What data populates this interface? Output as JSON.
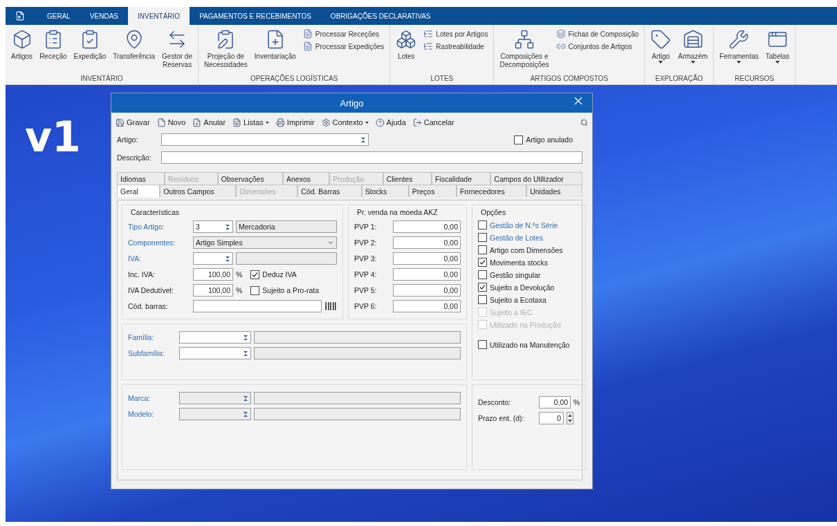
{
  "ribbon_tabs": [
    {
      "label": "GERAL",
      "selected": false
    },
    {
      "label": "VENDAS",
      "selected": false
    },
    {
      "label": "INVENTÁRIO",
      "selected": true
    },
    {
      "label": "PAGAMENTOS E RECEBIMENTOS",
      "selected": false
    },
    {
      "label": "OBRIGAÇÕES DECLARATIVAS",
      "selected": false
    }
  ],
  "ribbon_groups": [
    {
      "label": "INVENTÁRIO",
      "items": [
        {
          "kind": "large",
          "label": "Artigos"
        },
        {
          "kind": "large",
          "label": "Receção"
        },
        {
          "kind": "large",
          "label": "Expedição"
        },
        {
          "kind": "large",
          "label": "Transferência"
        },
        {
          "kind": "large",
          "label": "Gestor de\nReservas"
        }
      ]
    },
    {
      "label": "OPERAÇÕES LOGÍSTICAS",
      "items": [
        {
          "kind": "large",
          "label": "Projeção de\nNecessidades"
        },
        {
          "kind": "large",
          "label": "Inventariação"
        },
        {
          "kind": "small",
          "label": "Processar Receções"
        },
        {
          "kind": "small",
          "label": "Processar Expedições"
        }
      ]
    },
    {
      "label": "LOTES",
      "items": [
        {
          "kind": "large",
          "label": "Lotes"
        },
        {
          "kind": "small",
          "label": "Lotes por Artigos"
        },
        {
          "kind": "small",
          "label": "Rastreabilidade"
        }
      ]
    },
    {
      "label": "ARTIGOS COMPOSTOS",
      "items": [
        {
          "kind": "large",
          "label": "Composições e\nDecomposições"
        },
        {
          "kind": "small",
          "label": "Fichas de Composição"
        },
        {
          "kind": "small",
          "label": "Conjuntos de Artigos"
        }
      ]
    },
    {
      "label": "EXPLORAÇÃO",
      "items": [
        {
          "kind": "menu",
          "label": "Artigo"
        },
        {
          "kind": "menu",
          "label": "Armazém"
        }
      ]
    },
    {
      "label": "RECURSOS",
      "items": [
        {
          "kind": "menu",
          "label": "Ferramentas"
        },
        {
          "kind": "menu",
          "label": "Tabelas"
        }
      ]
    }
  ],
  "desktop": {
    "logo": "v1"
  },
  "dialog": {
    "title": "Artigo",
    "toolbar": [
      {
        "label": "Gravar",
        "dropdown": false
      },
      {
        "label": "Novo",
        "dropdown": false
      },
      {
        "label": "Anular",
        "dropdown": false
      },
      {
        "label": "Listas",
        "dropdown": true
      },
      {
        "label": "Imprimir",
        "dropdown": false
      },
      {
        "label": "Contexto",
        "dropdown": true
      },
      {
        "label": "Ajuda",
        "dropdown": false
      },
      {
        "label": "Cancelar",
        "dropdown": false
      }
    ],
    "artigo": {
      "label": "Artigo:"
    },
    "descricao": {
      "label": "Descrição:"
    },
    "artigo_anulado": {
      "label": "Artigo anulado",
      "checked": false
    },
    "tab_rows": [
      [
        {
          "label": "Idiomas",
          "selected": false,
          "disabled": false
        },
        {
          "label": "Resíduos",
          "selected": false,
          "disabled": true
        },
        {
          "label": "Observações",
          "selected": false,
          "disabled": false
        },
        {
          "label": "Anexos",
          "selected": false,
          "disabled": false
        },
        {
          "label": "Produção",
          "selected": false,
          "disabled": true
        },
        {
          "label": "Clientes",
          "selected": false,
          "disabled": false
        },
        {
          "label": "Fiscalidade",
          "selected": false,
          "disabled": false
        },
        {
          "label": "Campos do Utilizador",
          "selected": false,
          "disabled": false
        }
      ],
      [
        {
          "label": "Geral",
          "selected": true,
          "disabled": false
        },
        {
          "label": "Outros Campos",
          "selected": false,
          "disabled": false
        },
        {
          "label": "Dimensões",
          "selected": false,
          "disabled": true
        },
        {
          "label": "Cód. Barras",
          "selected": false,
          "disabled": false
        },
        {
          "label": "Stocks",
          "selected": false,
          "disabled": false
        },
        {
          "label": "Preços",
          "selected": false,
          "disabled": false
        },
        {
          "label": "Fornecedores",
          "selected": false,
          "disabled": false
        },
        {
          "label": "Unidades",
          "selected": false,
          "disabled": false
        }
      ]
    ],
    "caracteristicas": {
      "title": "Características",
      "tipo_artigo": {
        "label": "Tipo Artigo:",
        "link": true,
        "value": "3",
        "description": "Mercadoria"
      },
      "componentes": {
        "label": "Componentes:",
        "link": true,
        "value": "Artigo Simples"
      },
      "iva": {
        "label": "IVA:",
        "link": true
      },
      "inc_iva": {
        "label": "Inc. IVA:",
        "link": false,
        "value": "100,00",
        "unit": "%",
        "check": {
          "label": "Deduz IVA",
          "checked": true
        }
      },
      "iva_dedutivel": {
        "label": "IVA Dedutível:",
        "link": false,
        "value": "100,00",
        "unit": "%",
        "check": {
          "label": "Sujeito a Pro-rata",
          "checked": false
        }
      },
      "cod_barras": {
        "label": "Cód. barras:",
        "link": false
      }
    },
    "precos": {
      "title": "Pr. venda na moeda AKZ",
      "rows": [
        {
          "label": "PVP 1:",
          "value": "0,00"
        },
        {
          "label": "PVP 2:",
          "value": "0,00"
        },
        {
          "label": "PVP 3:",
          "value": "0,00"
        },
        {
          "label": "PVP 4:",
          "value": "0,00"
        },
        {
          "label": "PVP 5:",
          "value": "0,00"
        },
        {
          "label": "PVP 6:",
          "value": "0,00"
        }
      ]
    },
    "opcoes": {
      "title": "Opções",
      "items": [
        {
          "label": "Gestão de N.ºs Série",
          "checked": false,
          "disabled": false,
          "link": true
        },
        {
          "label": "Gestão de Lotes",
          "checked": false,
          "disabled": false,
          "link": true
        },
        {
          "label": "Artigo com Dimensões",
          "checked": false,
          "disabled": false,
          "link": false
        },
        {
          "label": "Movimenta stocks",
          "checked": true,
          "disabled": false,
          "link": false
        },
        {
          "label": "Gestão singular",
          "checked": false,
          "disabled": false,
          "link": false
        },
        {
          "label": "Sujeito a Devolução",
          "checked": true,
          "disabled": false,
          "link": false
        },
        {
          "label": "Sujeito a Ecotaxa",
          "checked": false,
          "disabled": false,
          "link": false
        },
        {
          "label": "Sujeito a IEC",
          "checked": false,
          "disabled": true,
          "link": false
        },
        {
          "label": "Utilizado na Produção",
          "checked": false,
          "disabled": true,
          "link": false
        }
      ],
      "extra": {
        "label": "Utilizado na Manutenção",
        "checked": false,
        "disabled": false,
        "link": false
      }
    },
    "familia": [
      {
        "label": "Família:",
        "link": true,
        "disabled": false
      },
      {
        "label": "Subfamília:",
        "link": true,
        "disabled": false
      }
    ],
    "marca": [
      {
        "label": "Marca:",
        "link": true,
        "disabled": true
      },
      {
        "label": "Modelo:",
        "link": true,
        "disabled": true
      }
    ],
    "desconto": {
      "label": "Desconto:",
      "value": "0,00",
      "unit": "%"
    },
    "prazo": {
      "label": "Prazo ent. (d):",
      "value": "0"
    }
  }
}
